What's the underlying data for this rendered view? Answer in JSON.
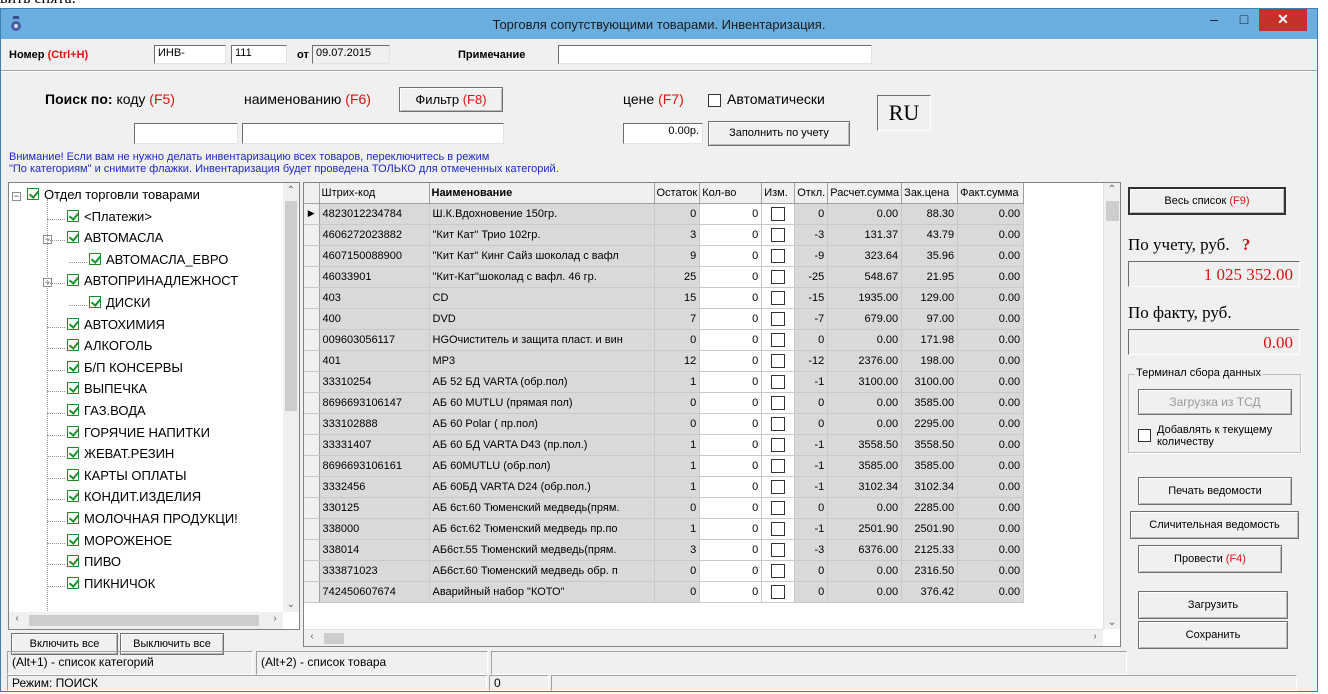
{
  "top_fragment": "вить снята.",
  "window": {
    "title": "Торговля сопутствующими товарами. Инвентаризация."
  },
  "header": {
    "number_label": "Номер",
    "number_hotkey": "(Ctrl+H)",
    "number_prefix": "ИНВ-",
    "number_value": "111",
    "date_label": "от",
    "date_value": "09.07.2015",
    "note_label": "Примечание",
    "note_value": ""
  },
  "search": {
    "label": "Поиск по:",
    "code_label": "коду",
    "code_hotkey": "(F5)",
    "name_label": "наименованию",
    "name_hotkey": "(F6)",
    "filter_label": "Фильтр",
    "filter_hotkey": "(F8)",
    "price_label": "цене",
    "price_hotkey": "(F7)",
    "auto_label": "Автоматически",
    "code_value": "",
    "name_value": "",
    "price_value": "0.00р.",
    "fill_button": "Заполнить по учету",
    "lang": "RU"
  },
  "notice": {
    "line1": "Внимание! Если вам не нужно делать инвентаризацию всех товаров, переключитесь в режим",
    "line2": "\"По категориям\" и снимите флажки. Инвентаризация будет проведена ТОЛЬКО для отмеченных категорий."
  },
  "tree": {
    "items": [
      {
        "label": "Отдел торговли товарами"
      },
      {
        "label": "<Платежи>"
      },
      {
        "label": "АВТОМАСЛА"
      },
      {
        "label": "АВТОМАСЛА_ЕВРО"
      },
      {
        "label": "АВТОПРИНАДЛЕЖНОСТ"
      },
      {
        "label": "ДИСКИ"
      },
      {
        "label": "АВТОХИМИЯ"
      },
      {
        "label": "АЛКОГОЛЬ"
      },
      {
        "label": "Б/П КОНСЕРВЫ"
      },
      {
        "label": "ВЫПЕЧКА"
      },
      {
        "label": "ГАЗ.ВОДА"
      },
      {
        "label": "ГОРЯЧИЕ НАПИТКИ"
      },
      {
        "label": "ЖЕВАТ.РЕЗИН"
      },
      {
        "label": "КАРТЫ ОПЛАТЫ"
      },
      {
        "label": "КОНДИТ.ИЗДЕЛИЯ"
      },
      {
        "label": "МОЛОЧНАЯ ПРОДУКЦИ!"
      },
      {
        "label": "МОРОЖЕНОЕ"
      },
      {
        "label": "ПИВО"
      },
      {
        "label": "ПИКНИЧОК"
      }
    ],
    "enable_all": "Включить все",
    "disable_all": "Выключить все"
  },
  "grid": {
    "columns": [
      "Штрих-код",
      "Наименование",
      "Остаток",
      "Кол-во",
      "Изм.",
      "Откл.",
      "Расчет.сумма",
      "Зак.цена",
      "Факт.сумма"
    ],
    "rows": [
      [
        "4823012234784",
        "Ш.К.Вдохновение 150гр.",
        "0",
        "0",
        "0",
        "0.00",
        "88.30",
        "0.00"
      ],
      [
        "4606272023882",
        "\"Кит Кат\"  Трио 102гр.",
        "3",
        "0",
        "-3",
        "131.37",
        "43.79",
        "0.00"
      ],
      [
        "4607150088900",
        "\"Кит Кат\"  Кинг Сайз шоколад с вафл",
        "9",
        "0",
        "-9",
        "323.64",
        "35.96",
        "0.00"
      ],
      [
        "46033901",
        "\"Кит-Кат\"шоколад с вафл. 46 гр.",
        "25",
        "0",
        "-25",
        "548.67",
        "21.95",
        "0.00"
      ],
      [
        "403",
        "CD",
        "15",
        "0",
        "-15",
        "1935.00",
        "129.00",
        "0.00"
      ],
      [
        "400",
        "DVD",
        "7",
        "0",
        "-7",
        "679.00",
        "97.00",
        "0.00"
      ],
      [
        "009603056117",
        "HGОчиститель и защита пласт. и вин",
        "0",
        "0",
        "0",
        "0.00",
        "171.98",
        "0.00"
      ],
      [
        "401",
        "MP3",
        "12",
        "0",
        "-12",
        "2376.00",
        "198.00",
        "0.00"
      ],
      [
        "33310254",
        "АБ 52 БД VARTA (обр.пол)",
        "1",
        "0",
        "-1",
        "3100.00",
        "3100.00",
        "0.00"
      ],
      [
        "8696693106147",
        "АБ 60 MUTLU (прямая пол)",
        "0",
        "0",
        "0",
        "0.00",
        "3585.00",
        "0.00"
      ],
      [
        "333102888",
        "АБ 60 Polar ( пр.пол)",
        "0",
        "0",
        "0",
        "0.00",
        "2295.00",
        "0.00"
      ],
      [
        "33331407",
        "АБ 60 БД VARTA D43 (пр.пол.)",
        "1",
        "0",
        "-1",
        "3558.50",
        "3558.50",
        "0.00"
      ],
      [
        "8696693106161",
        "АБ 60MUTLU (обр.пол)",
        "1",
        "0",
        "-1",
        "3585.00",
        "3585.00",
        "0.00"
      ],
      [
        "3332456",
        "АБ 60БД VARTA D24 (обр.пол.)",
        "1",
        "0",
        "-1",
        "3102.34",
        "3102.34",
        "0.00"
      ],
      [
        "330125",
        "АБ 6ст.60 Тюменский медведь(прям.",
        "0",
        "0",
        "0",
        "0.00",
        "2285.00",
        "0.00"
      ],
      [
        "338000",
        "АБ 6ст.62 Тюменский медведь пр.по",
        "1",
        "0",
        "-1",
        "2501.90",
        "2501.90",
        "0.00"
      ],
      [
        "338014",
        "АБ6ст.55 Тюменский медведь(прям.",
        "3",
        "0",
        "-3",
        "6376.00",
        "2125.33",
        "0.00"
      ],
      [
        "333871023",
        "АБ6ст.60 Тюменский медведь обр. п",
        "0",
        "0",
        "0",
        "0.00",
        "2316.50",
        "0.00"
      ],
      [
        "742450607674",
        "Аварийный набор \"КОТО\"",
        "0",
        "0",
        "0",
        "0.00",
        "376.42",
        "0.00"
      ]
    ]
  },
  "right_panel": {
    "whole_list": "Весь список",
    "whole_list_hotkey": "(F9)",
    "by_account_label": "По учету, руб.",
    "question_mark": "?",
    "by_account_value": "1 025 352.00",
    "by_fact_label": "По факту, руб.",
    "by_fact_value": "0.00",
    "terminal_caption": "Терминал сбора данных",
    "load_tsd": "Загрузка из ТСД",
    "add_to_current": "Добавлять к текущему количеству",
    "print_sheet": "Печать ведомости",
    "compare_sheet": "Сличительная ведомость",
    "post": "Провести",
    "post_hotkey": "(F4)",
    "load": "Загрузить",
    "save": "Сохранить"
  },
  "statusbar": {
    "hint1": "(Alt+1) - список категорий",
    "hint2": "(Alt+2) - список товара",
    "mode": "Режим: ПОИСК",
    "count": "0"
  },
  "colors": {
    "title_bar": "#6aaee0",
    "close": "#c7312b",
    "accent_red": "#e01010",
    "notice_blue": "#1e28c8",
    "check_green": "#1d8f27"
  }
}
